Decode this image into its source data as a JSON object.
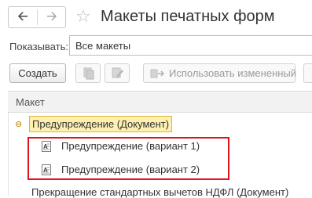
{
  "window": {
    "title": "Макеты печатных форм"
  },
  "nav": {
    "back_icon": "arrow-left-icon",
    "forward_icon": "arrow-right-icon",
    "favorite_icon": "star-icon"
  },
  "filter": {
    "label": "Показывать:",
    "value": "Все макеты"
  },
  "toolbar": {
    "create_label": "Создать",
    "use_changed_label": "Использовать измененный"
  },
  "table": {
    "column": "Макет",
    "rows": [
      {
        "text": "Предупреждение (Документ)",
        "level": 0,
        "expanded": true,
        "selected": true
      },
      {
        "text": "Предупреждение (вариант 1)",
        "level": 1,
        "icon": "spreadsheet-template-icon"
      },
      {
        "text": "Предупреждение (вариант 2)",
        "level": 1,
        "icon": "spreadsheet-template-icon"
      },
      {
        "text": "Прекращение стандартных вычетов НДФЛ (Документ)",
        "level": 0
      }
    ]
  },
  "colors": {
    "highlight_border": "#e0121a",
    "selection_fill": "#fdf0b0",
    "selection_border": "#e3b52b"
  }
}
